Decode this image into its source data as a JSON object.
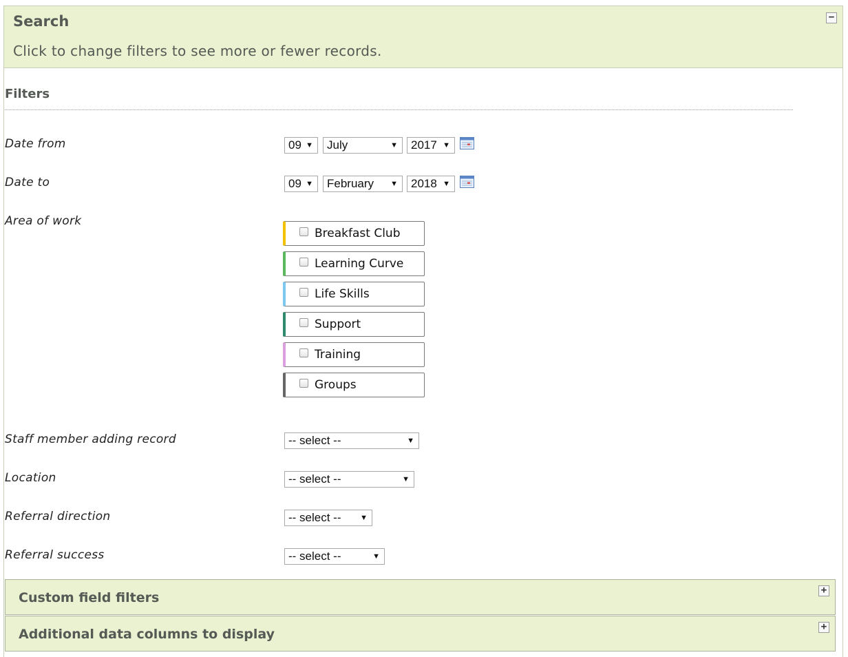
{
  "search": {
    "title": "Search",
    "subtitle": "Click to change filters to see more or fewer records.",
    "collapse_icon": "minus-toggle-icon",
    "collapse_glyph": "−"
  },
  "filters": {
    "heading": "Filters",
    "date_from": {
      "label": "Date from",
      "day": "09",
      "month": "July",
      "year": "2017"
    },
    "date_to": {
      "label": "Date to",
      "day": "09",
      "month": "February",
      "year": "2018"
    },
    "area_of_work": {
      "label": "Area of work",
      "items": [
        {
          "label": "Breakfast Club",
          "color": "#f2c200",
          "checked": false
        },
        {
          "label": "Learning Curve",
          "color": "#5cb85c",
          "checked": false
        },
        {
          "label": "Life Skills",
          "color": "#7ec8f0",
          "checked": false
        },
        {
          "label": "Support",
          "color": "#2e8b6e",
          "checked": false
        },
        {
          "label": "Training",
          "color": "#d9a0dd",
          "checked": false
        },
        {
          "label": "Groups",
          "color": "#666666",
          "checked": false
        }
      ]
    },
    "staff_member": {
      "label": "Staff member adding record",
      "value": "-- select --"
    },
    "location": {
      "label": "Location",
      "value": "-- select --"
    },
    "referral_direction": {
      "label": "Referral direction",
      "value": "-- select --"
    },
    "referral_success": {
      "label": "Referral success",
      "value": "-- select --"
    }
  },
  "custom_field_filters": {
    "title": "Custom field filters",
    "expand_glyph": "+"
  },
  "additional_columns": {
    "title": "Additional data columns to display",
    "expand_glyph": "+"
  },
  "colors": {
    "header_bg": "#eaf2d2",
    "header_text": "#555a55"
  }
}
